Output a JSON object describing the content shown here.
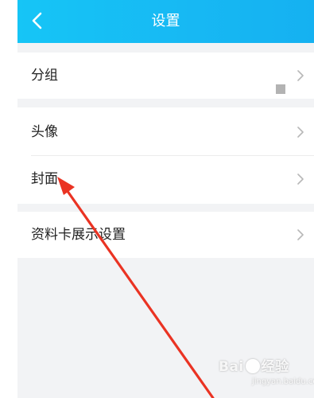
{
  "header": {
    "title": "设置",
    "back_icon": "chevron-left-icon"
  },
  "settings": {
    "group_label": "分组",
    "avatar_label": "头像",
    "cover_label": "封面",
    "profile_card_label": "资料卡展示设置"
  },
  "colors": {
    "header_bg": "#17b8f3",
    "page_bg": "#f2f3f5",
    "annotation_arrow": "#ea3323"
  },
  "watermark": {
    "brand": "Bai",
    "brand_suffix": "经验",
    "sub": "jingyan.baidu.com"
  }
}
